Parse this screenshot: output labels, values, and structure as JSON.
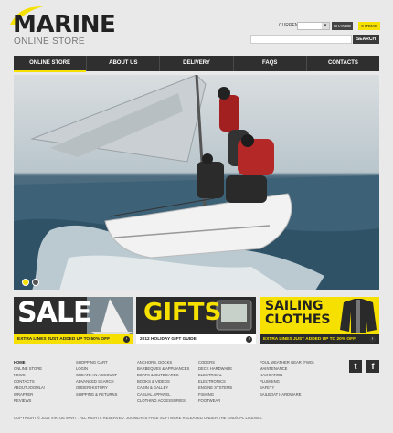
{
  "brand": {
    "name": "MARINE",
    "tagline": "ONLINE STORE"
  },
  "header": {
    "currencies_label": "CURRENCIES:",
    "currency_value": "",
    "change_label": "CHANGE",
    "items_label": "0 ITEMS",
    "search_placeholder": "",
    "search_label": "SEARCH"
  },
  "nav": [
    {
      "label": "ONLINE STORE",
      "active": true
    },
    {
      "label": "ABOUT US"
    },
    {
      "label": "DELIVERY"
    },
    {
      "label": "FAQS"
    },
    {
      "label": "CONTACTS"
    }
  ],
  "banners": {
    "sale": {
      "title": "SALE",
      "foot": "EXTRA LINES JUST ADDED UP TO 50% OFF"
    },
    "gifts": {
      "title": "GIFTS",
      "foot": "2012 HOLIDAY GIFT GUIDE"
    },
    "sailing": {
      "title1": "SAILING",
      "title2": "CLOTHES",
      "foot": "EXTRA LINES JUST ADDED UP TO 20% OFF"
    }
  },
  "footer": {
    "col1": [
      "HOME",
      "ONLINE STORE",
      "NEWS",
      "CONTACTS",
      "ABOUT JOOMLA!",
      "WRAPPER",
      "REVIEWS"
    ],
    "col2": [
      "SHOPPING CART",
      "LOGIN",
      "CREATE AN ACCOUNT",
      "ADVANCED SEARCH",
      "ORDER HISTORY",
      "SHIPPING & RETURNS"
    ],
    "col3": [
      "ANCHORS, DOCKS",
      "BARBEQUES & APPLIANCES",
      "BOATS & OUTBOARDS",
      "BOOKS & VIDEOS",
      "CABIN & GALLEY",
      "CASUAL APPAREL",
      "CLOTHING ACCESSORIES"
    ],
    "col4": [
      "CODERS",
      "DECK HARDWARE",
      "ELECTRICAL",
      "ELECTRONICS",
      "ENGINE SYSTEMS",
      "FISHING",
      "FOOTWEAR"
    ],
    "col5": [
      "FOUL WEATHER GEAR (FWG)",
      "MAINTENANCE",
      "NAVIGATION",
      "PLUMBING",
      "SAFETY",
      "SAILBOAT HARDWARE"
    ],
    "copyright": "COPYRIGHT © 2012 VIRTUE MART . ALL RIGHTS RESERVED. JOOMLA! IS FREE SOFTWARE RELEASED UNDER THE GNU/GPL LICENSE."
  },
  "colors": {
    "accent": "#f6e000",
    "dark": "#2f2f2f"
  },
  "icons": [
    "twitter-icon",
    "facebook-icon",
    "arrow-right-icon"
  ]
}
